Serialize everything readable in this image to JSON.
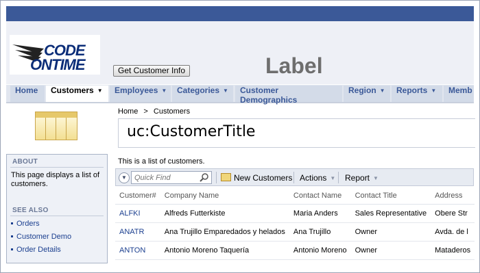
{
  "logo": {
    "line1": "CODE",
    "line2": "ONTIME"
  },
  "header": {
    "button_label": "Get Customer Info",
    "big_label": "Label"
  },
  "menu": [
    {
      "label": "Home",
      "dropdown": false
    },
    {
      "label": "Customers",
      "dropdown": true,
      "active": true
    },
    {
      "label": "Employees",
      "dropdown": true
    },
    {
      "label": "Categories",
      "dropdown": true
    },
    {
      "label": "Customer Demographics",
      "dropdown": false
    },
    {
      "label": "Region",
      "dropdown": true
    },
    {
      "label": "Reports",
      "dropdown": true
    },
    {
      "label": "Memb",
      "dropdown": false
    }
  ],
  "breadcrumb": {
    "home": "Home",
    "separator": ">",
    "current": "Customers"
  },
  "page_title": "uc:CustomerTitle",
  "sidebar": {
    "about_header": "ABOUT",
    "about_text": "This page displays a list of customers.",
    "see_also_header": "SEE ALSO",
    "links": [
      "Orders",
      "Customer Demo",
      "Order Details"
    ]
  },
  "description": "This is a list of customers.",
  "toolbar": {
    "quick_find_placeholder": "Quick Find",
    "new_label": "New Customers",
    "actions_label": "Actions",
    "report_label": "Report"
  },
  "grid": {
    "columns": [
      "Customer#",
      "Company Name",
      "Contact Name",
      "Contact Title",
      "Address"
    ],
    "rows": [
      [
        "ALFKI",
        "Alfreds Futterkiste",
        "Maria Anders",
        "Sales Representative",
        "Obere Str"
      ],
      [
        "ANATR",
        "Ana Trujillo Emparedados y helados",
        "Ana Trujillo",
        "Owner",
        "Avda. de l"
      ],
      [
        "ANTON",
        "Antonio Moreno Taquería",
        "Antonio Moreno",
        "Owner",
        "Mataderos"
      ]
    ]
  },
  "colors": {
    "topbar": "#3b5998",
    "link": "#1b3f8f",
    "menu_text": "#3b5998",
    "label_gray": "#6e6e6e"
  }
}
